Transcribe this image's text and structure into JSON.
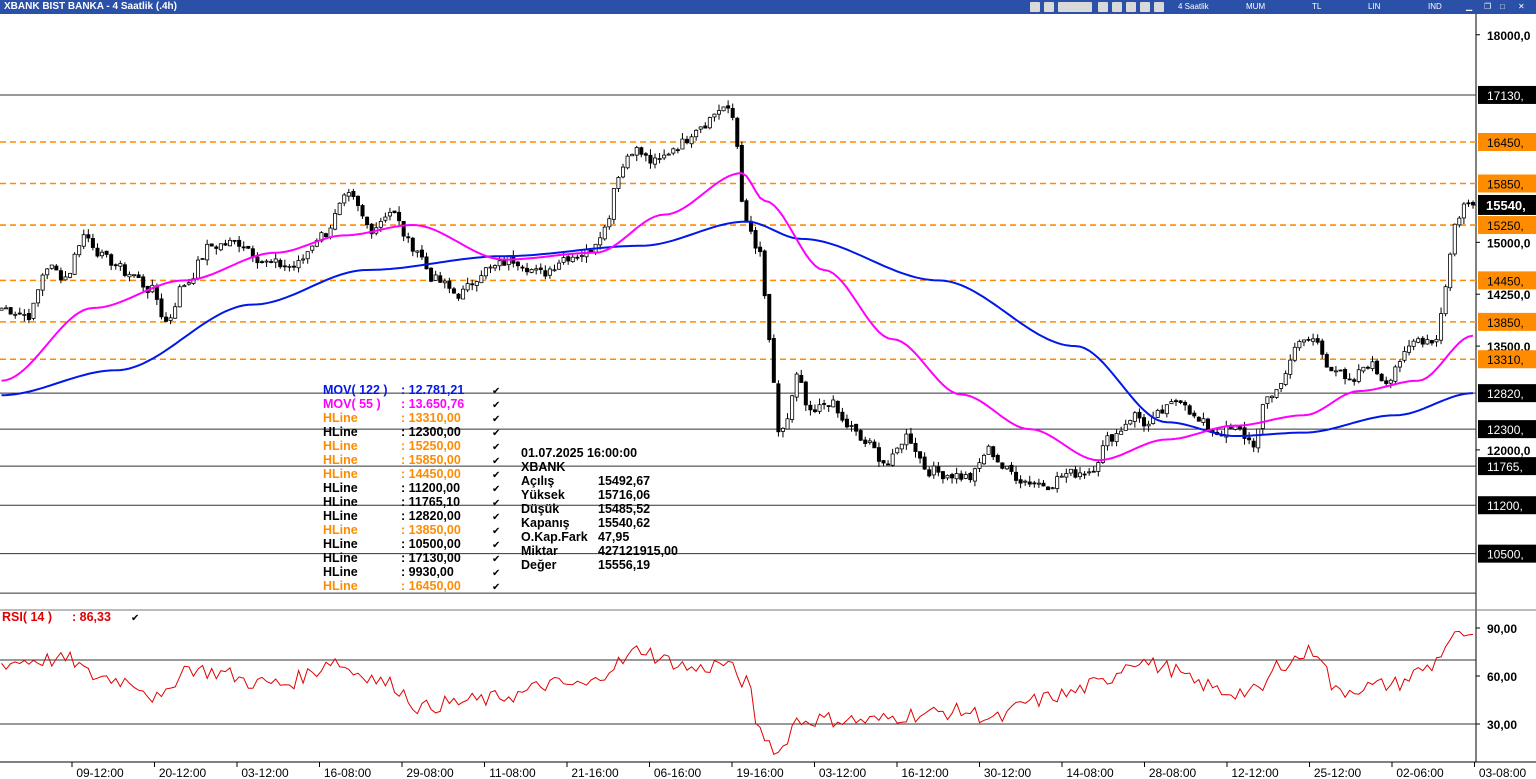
{
  "window": {
    "title": "XBANK BIST BANKA - 4 Saatlik (.4h)",
    "toolbar": [
      "4 Saatlik",
      "MUM",
      "TL",
      "LIN",
      "IND"
    ]
  },
  "chart_data": {
    "type": "line",
    "symbol": "XBANK",
    "price_axis": {
      "ylim": [
        9700,
        18300
      ],
      "ticks": [
        {
          "value": 18000,
          "label": "18000,0"
        },
        {
          "value": 15000,
          "label": "15000,0"
        },
        {
          "value": 14250,
          "label": "14250,0"
        },
        {
          "value": 13500,
          "label": "13500,0"
        },
        {
          "value": 12000,
          "label": "12000,0"
        }
      ]
    },
    "x_tick_labels": [
      "09-12:00",
      "20-12:00",
      "03-12:00",
      "16-08:00",
      "29-08:00",
      "11-08:00",
      "21-16:00",
      "06-16:00",
      "19-16:00",
      "03-12:00",
      "16-12:00",
      "30-12:00",
      "14-08:00",
      "28-08:00",
      "12-12:00",
      "25-12:00",
      "02-06:00",
      "03-08:00"
    ],
    "close_anchors": [
      {
        "i": 0,
        "v": 14050
      },
      {
        "i": 6,
        "v": 13950
      },
      {
        "i": 10,
        "v": 14650
      },
      {
        "i": 14,
        "v": 14500
      },
      {
        "i": 18,
        "v": 15100
      },
      {
        "i": 23,
        "v": 14750
      },
      {
        "i": 28,
        "v": 14550
      },
      {
        "i": 33,
        "v": 14300
      },
      {
        "i": 36,
        "v": 13850
      },
      {
        "i": 40,
        "v": 14400
      },
      {
        "i": 46,
        "v": 14950
      },
      {
        "i": 52,
        "v": 15000
      },
      {
        "i": 58,
        "v": 14700
      },
      {
        "i": 64,
        "v": 14650
      },
      {
        "i": 70,
        "v": 15100
      },
      {
        "i": 76,
        "v": 15650
      },
      {
        "i": 81,
        "v": 15200
      },
      {
        "i": 85,
        "v": 15450
      },
      {
        "i": 90,
        "v": 14950
      },
      {
        "i": 95,
        "v": 14450
      },
      {
        "i": 100,
        "v": 14250
      },
      {
        "i": 106,
        "v": 14600
      },
      {
        "i": 112,
        "v": 14750
      },
      {
        "i": 118,
        "v": 14550
      },
      {
        "i": 124,
        "v": 14800
      },
      {
        "i": 128,
        "v": 14850
      },
      {
        "i": 132,
        "v": 15200
      },
      {
        "i": 135,
        "v": 16000
      },
      {
        "i": 138,
        "v": 16350
      },
      {
        "i": 143,
        "v": 16150
      },
      {
        "i": 148,
        "v": 16400
      },
      {
        "i": 153,
        "v": 16700
      },
      {
        "i": 158,
        "v": 16950
      },
      {
        "i": 160,
        "v": 16800
      },
      {
        "i": 163,
        "v": 15250
      },
      {
        "i": 166,
        "v": 14800
      },
      {
        "i": 168,
        "v": 13600
      },
      {
        "i": 170,
        "v": 12200
      },
      {
        "i": 172,
        "v": 12450
      },
      {
        "i": 174,
        "v": 13050
      },
      {
        "i": 177,
        "v": 12500
      },
      {
        "i": 181,
        "v": 12700
      },
      {
        "i": 185,
        "v": 12350
      },
      {
        "i": 189,
        "v": 12100
      },
      {
        "i": 194,
        "v": 11800
      },
      {
        "i": 198,
        "v": 12200
      },
      {
        "i": 203,
        "v": 11700
      },
      {
        "i": 207,
        "v": 11650
      },
      {
        "i": 212,
        "v": 11600
      },
      {
        "i": 216,
        "v": 12000
      },
      {
        "i": 220,
        "v": 11700
      },
      {
        "i": 224,
        "v": 11550
      },
      {
        "i": 229,
        "v": 11500
      },
      {
        "i": 233,
        "v": 11650
      },
      {
        "i": 238,
        "v": 11700
      },
      {
        "i": 243,
        "v": 12200
      },
      {
        "i": 248,
        "v": 12500
      },
      {
        "i": 251,
        "v": 12350
      },
      {
        "i": 254,
        "v": 12550
      },
      {
        "i": 258,
        "v": 12750
      },
      {
        "i": 262,
        "v": 12400
      },
      {
        "i": 266,
        "v": 12250
      },
      {
        "i": 270,
        "v": 12300
      },
      {
        "i": 274,
        "v": 12100
      },
      {
        "i": 277,
        "v": 12750
      },
      {
        "i": 280,
        "v": 12950
      },
      {
        "i": 283,
        "v": 13500
      },
      {
        "i": 287,
        "v": 13600
      },
      {
        "i": 291,
        "v": 13200
      },
      {
        "i": 295,
        "v": 12950
      },
      {
        "i": 299,
        "v": 13250
      },
      {
        "i": 303,
        "v": 13000
      },
      {
        "i": 306,
        "v": 13300
      },
      {
        "i": 310,
        "v": 13600
      },
      {
        "i": 314,
        "v": 13600
      },
      {
        "i": 316,
        "v": 14400
      },
      {
        "i": 318,
        "v": 15250
      },
      {
        "i": 320,
        "v": 15540
      }
    ],
    "series": [
      {
        "name": "MOV( 122 )",
        "color": "#0018e8",
        "anchors": [
          {
            "i": 0,
            "v": 12790
          },
          {
            "i": 25,
            "v": 13150
          },
          {
            "i": 55,
            "v": 14100
          },
          {
            "i": 80,
            "v": 14600
          },
          {
            "i": 110,
            "v": 14800
          },
          {
            "i": 140,
            "v": 14950
          },
          {
            "i": 163,
            "v": 15300
          },
          {
            "i": 175,
            "v": 15050
          },
          {
            "i": 205,
            "v": 14450
          },
          {
            "i": 235,
            "v": 13500
          },
          {
            "i": 255,
            "v": 12400
          },
          {
            "i": 270,
            "v": 12200
          },
          {
            "i": 285,
            "v": 12250
          },
          {
            "i": 305,
            "v": 12500
          },
          {
            "i": 322,
            "v": 12820
          }
        ]
      },
      {
        "name": "MOV( 55 )",
        "color": "#ff00ff",
        "anchors": [
          {
            "i": 0,
            "v": 13000
          },
          {
            "i": 20,
            "v": 14050
          },
          {
            "i": 40,
            "v": 14450
          },
          {
            "i": 60,
            "v": 14850
          },
          {
            "i": 75,
            "v": 15100
          },
          {
            "i": 90,
            "v": 15250
          },
          {
            "i": 110,
            "v": 14750
          },
          {
            "i": 130,
            "v": 14850
          },
          {
            "i": 145,
            "v": 15400
          },
          {
            "i": 162,
            "v": 16000
          },
          {
            "i": 167,
            "v": 15600
          },
          {
            "i": 180,
            "v": 14600
          },
          {
            "i": 195,
            "v": 13600
          },
          {
            "i": 210,
            "v": 12800
          },
          {
            "i": 225,
            "v": 12300
          },
          {
            "i": 240,
            "v": 11850
          },
          {
            "i": 255,
            "v": 12150
          },
          {
            "i": 270,
            "v": 12350
          },
          {
            "i": 285,
            "v": 12500
          },
          {
            "i": 297,
            "v": 12850
          },
          {
            "i": 310,
            "v": 13000
          },
          {
            "i": 322,
            "v": 13650
          }
        ]
      }
    ],
    "legend": [
      {
        "name": "MOV( 122 )",
        "value": ": 12.781,21",
        "color": "#0018e8"
      },
      {
        "name": "MOV( 55 )",
        "value": ": 13.650,76",
        "color": "#ff00ff"
      },
      {
        "name": "HLine",
        "value": ": 13310,00",
        "color": "#ff8c00"
      },
      {
        "name": "HLine",
        "value": ": 12300,00",
        "color": "#000000"
      },
      {
        "name": "HLine",
        "value": ": 15250,00",
        "color": "#ff8c00"
      },
      {
        "name": "HLine",
        "value": ": 15850,00",
        "color": "#ff8c00"
      },
      {
        "name": "HLine",
        "value": ": 14450,00",
        "color": "#ff8c00"
      },
      {
        "name": "HLine",
        "value": ": 11200,00",
        "color": "#000000"
      },
      {
        "name": "HLine",
        "value": ": 11765,10",
        "color": "#000000"
      },
      {
        "name": "HLine",
        "value": ": 12820,00",
        "color": "#000000"
      },
      {
        "name": "HLine",
        "value": ": 13850,00",
        "color": "#ff8c00"
      },
      {
        "name": "HLine",
        "value": ": 10500,00",
        "color": "#000000"
      },
      {
        "name": "HLine",
        "value": ": 17130,00",
        "color": "#000000"
      },
      {
        "name": "HLine",
        "value": ": 9930,00",
        "color": "#000000"
      },
      {
        "name": "HLine",
        "value": ": 16450,00",
        "color": "#ff8c00"
      }
    ],
    "hlines": [
      {
        "value": 17130,
        "label": "17130,",
        "style": "solid"
      },
      {
        "value": 16450,
        "label": "16450,",
        "style": "dashed"
      },
      {
        "value": 15850,
        "label": "15850,",
        "style": "dashed"
      },
      {
        "value": 15250,
        "label": "15250,",
        "style": "dashed"
      },
      {
        "value": 14450,
        "label": "14450,",
        "style": "dashed"
      },
      {
        "value": 13850,
        "label": "13850,",
        "style": "dashed"
      },
      {
        "value": 13310,
        "label": "13310,",
        "style": "dashed"
      },
      {
        "value": 12820,
        "label": "12820,",
        "style": "solid"
      },
      {
        "value": 12300,
        "label": "12300,",
        "style": "solid"
      },
      {
        "value": 11765.1,
        "label": "11765,",
        "style": "solid"
      },
      {
        "value": 11200,
        "label": "11200,",
        "style": "solid"
      },
      {
        "value": 10500,
        "label": "10500,",
        "style": "solid"
      },
      {
        "value": 9930,
        "label": "",
        "style": "solid"
      }
    ],
    "last_price": {
      "value": 15540,
      "label": "15540,"
    },
    "info_box": {
      "date": "01.07.2025  16:00:00",
      "symbol": "XBANK",
      "rows": [
        {
          "label": "Açılış",
          "value": "15492,67"
        },
        {
          "label": "Yüksek",
          "value": "15716,06"
        },
        {
          "label": "Düşük",
          "value": "15485,52"
        },
        {
          "label": "Kapanış",
          "value": "15540,62"
        },
        {
          "label": "O.Kap.Fark",
          "value": "47,95"
        },
        {
          "label": "Miktar",
          "value": "427121915,00"
        },
        {
          "label": "Değer",
          "value": "15556,19"
        }
      ]
    },
    "rsi": {
      "label": "RSI( 14 )",
      "value": ": 86,33",
      "ylim": [
        10,
        100
      ],
      "levels": [
        70,
        30
      ],
      "ticks": [
        {
          "value": 90,
          "label": "90,00"
        },
        {
          "value": 60,
          "label": "60,00"
        },
        {
          "value": 30,
          "label": "30,00"
        }
      ],
      "anchors": [
        {
          "i": 0,
          "v": 68
        },
        {
          "i": 8,
          "v": 70
        },
        {
          "i": 15,
          "v": 70
        },
        {
          "i": 20,
          "v": 60
        },
        {
          "i": 28,
          "v": 57
        },
        {
          "i": 35,
          "v": 45
        },
        {
          "i": 40,
          "v": 65
        },
        {
          "i": 48,
          "v": 62
        },
        {
          "i": 55,
          "v": 56
        },
        {
          "i": 62,
          "v": 55
        },
        {
          "i": 68,
          "v": 62
        },
        {
          "i": 72,
          "v": 70
        },
        {
          "i": 78,
          "v": 62
        },
        {
          "i": 85,
          "v": 55
        },
        {
          "i": 92,
          "v": 40
        },
        {
          "i": 98,
          "v": 43
        },
        {
          "i": 105,
          "v": 45
        },
        {
          "i": 112,
          "v": 48
        },
        {
          "i": 120,
          "v": 55
        },
        {
          "i": 128,
          "v": 54
        },
        {
          "i": 135,
          "v": 68
        },
        {
          "i": 140,
          "v": 77
        },
        {
          "i": 145,
          "v": 70
        },
        {
          "i": 152,
          "v": 64
        },
        {
          "i": 158,
          "v": 68
        },
        {
          "i": 163,
          "v": 56
        },
        {
          "i": 166,
          "v": 25
        },
        {
          "i": 170,
          "v": 12
        },
        {
          "i": 174,
          "v": 32
        },
        {
          "i": 180,
          "v": 33
        },
        {
          "i": 190,
          "v": 32
        },
        {
          "i": 200,
          "v": 36
        },
        {
          "i": 210,
          "v": 38
        },
        {
          "i": 218,
          "v": 33
        },
        {
          "i": 225,
          "v": 44
        },
        {
          "i": 232,
          "v": 48
        },
        {
          "i": 240,
          "v": 55
        },
        {
          "i": 248,
          "v": 70
        },
        {
          "i": 255,
          "v": 65
        },
        {
          "i": 262,
          "v": 55
        },
        {
          "i": 268,
          "v": 50
        },
        {
          "i": 275,
          "v": 50
        },
        {
          "i": 280,
          "v": 68
        },
        {
          "i": 288,
          "v": 76
        },
        {
          "i": 292,
          "v": 50
        },
        {
          "i": 298,
          "v": 53
        },
        {
          "i": 305,
          "v": 55
        },
        {
          "i": 312,
          "v": 65
        },
        {
          "i": 318,
          "v": 84
        },
        {
          "i": 322,
          "v": 86
        }
      ]
    }
  }
}
